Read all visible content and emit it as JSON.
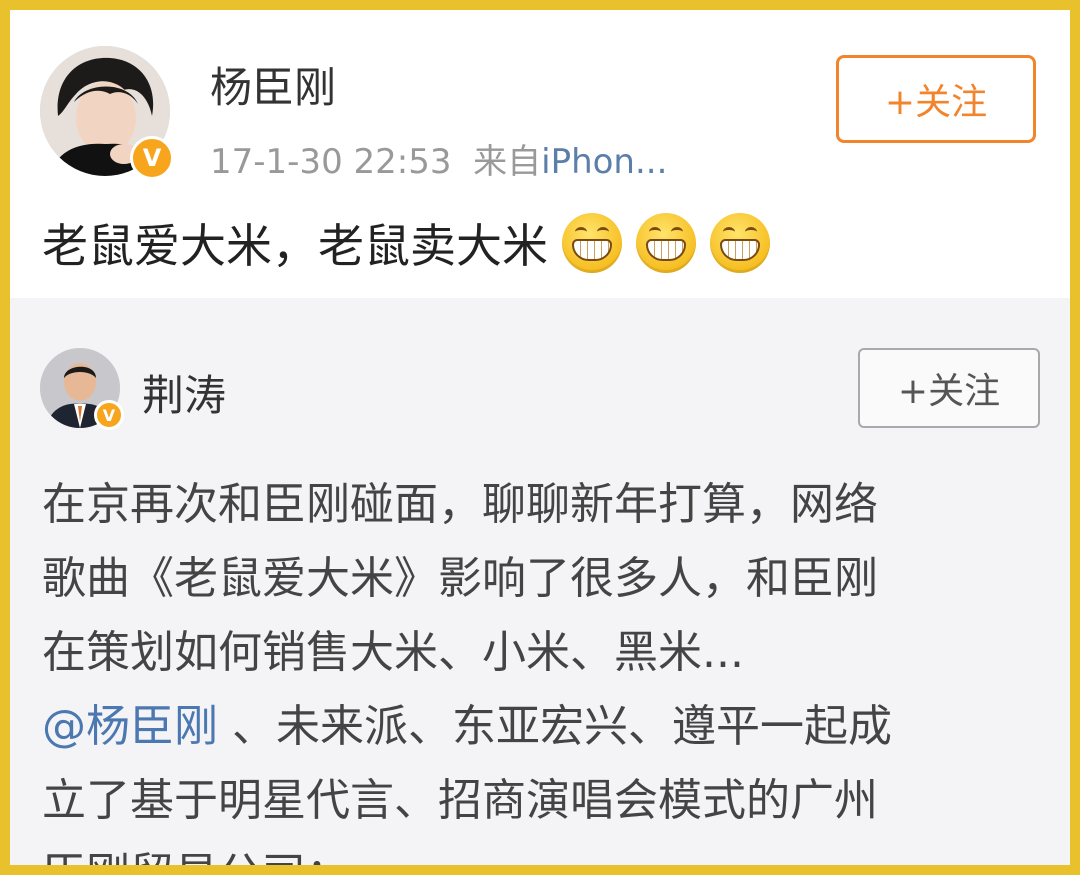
{
  "post": {
    "author": "杨臣刚",
    "time": "17-1-30 22:53",
    "source_prefix": "来自",
    "source": "iPhon...",
    "follow_label": "+关注",
    "text": "老鼠爱大米，老鼠卖大米",
    "emoji": "grin-emoji",
    "emoji_count": 3,
    "verified_badge": "V"
  },
  "quote": {
    "author": "荆涛",
    "follow_label": "+关注",
    "verified_badge": "V",
    "lines": [
      "在京再次和臣刚碰面，聊聊新年打算，网络",
      "歌曲《老鼠爱大米》影响了很多人，和臣刚",
      "在策划如何销售大米、小米、黑米..."
    ],
    "mention": "@杨臣刚",
    "mention_rest": " 、未来派、东亚宏兴、遵平一起成",
    "lines_after": [
      "立了基于明星代言、招商演唱会模式的广州",
      "臣刚贸易公司；"
    ]
  },
  "colors": {
    "frame": "#e8c12c",
    "follow_orange": "#f2842b",
    "link_blue": "#4b78b0",
    "verified": "#f7a51c"
  }
}
